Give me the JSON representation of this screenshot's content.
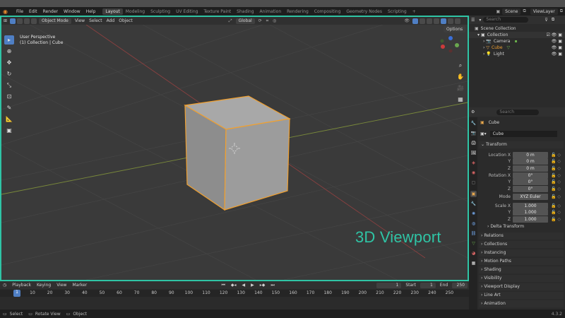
{
  "menu": [
    "File",
    "Edit",
    "Render",
    "Window",
    "Help"
  ],
  "workspaces": [
    "Layout",
    "Modeling",
    "Sculpting",
    "UV Editing",
    "Texture Paint",
    "Shading",
    "Animation",
    "Rendering",
    "Compositing",
    "Geometry Nodes",
    "Scripting",
    "+"
  ],
  "scene": {
    "name": "Scene",
    "view_layer": "ViewLayer"
  },
  "viewport": {
    "mode": "Object Mode",
    "view": "View",
    "select": "Select",
    "add": "Add",
    "object": "Object",
    "orientation": "Global",
    "options": "Options",
    "perspective": "User Perspective",
    "collection_info": "(1) Collection | Cube",
    "overlay_label": "3D Viewport"
  },
  "outliner": {
    "search_placeholder": "Search",
    "scene_collection": "Scene Collection",
    "items": [
      {
        "label": "Collection"
      },
      {
        "label": "Camera"
      },
      {
        "label": "Cube"
      },
      {
        "label": "Light"
      }
    ]
  },
  "properties": {
    "search_placeholder": "Search",
    "object_name": "Cube",
    "mesh_name": "Cube",
    "transform_label": "Transform",
    "location": [
      {
        "label": "Location X",
        "value": "0 m"
      },
      {
        "label": "Y",
        "value": "0 m"
      },
      {
        "label": "Z",
        "value": "0 m"
      }
    ],
    "rotation": [
      {
        "label": "Rotation X",
        "value": "0°"
      },
      {
        "label": "Y",
        "value": "0°"
      },
      {
        "label": "Z",
        "value": "0°"
      }
    ],
    "mode": {
      "label": "Mode",
      "value": "XYZ Euler"
    },
    "scale": [
      {
        "label": "Scale X",
        "value": "1.000"
      },
      {
        "label": "Y",
        "value": "1.000"
      },
      {
        "label": "Z",
        "value": "1.000"
      }
    ],
    "delta": "Delta Transform",
    "panels": [
      "Relations",
      "Collections",
      "Instancing",
      "Motion Paths",
      "Shading",
      "Visibility",
      "Viewport Display",
      "Line Art",
      "Animation"
    ]
  },
  "timeline": {
    "menu": [
      "Playback",
      "Keying",
      "View",
      "Marker"
    ],
    "current_frame": "1",
    "start_label": "Start",
    "start": "1",
    "end_label": "End",
    "end": "250",
    "ticks": [
      "1",
      "10",
      "20",
      "30",
      "40",
      "50",
      "60",
      "70",
      "80",
      "90",
      "100",
      "110",
      "120",
      "130",
      "140",
      "150",
      "160",
      "170",
      "180",
      "190",
      "200",
      "210",
      "220",
      "230",
      "240",
      "250"
    ]
  },
  "status": {
    "select": "Select",
    "rotate": "Rotate View",
    "object": "Object",
    "version": "4.3.2"
  },
  "colors": {
    "accent": "#2fc4a5",
    "selection": "#f0a030",
    "active": "#4f7fc4"
  }
}
